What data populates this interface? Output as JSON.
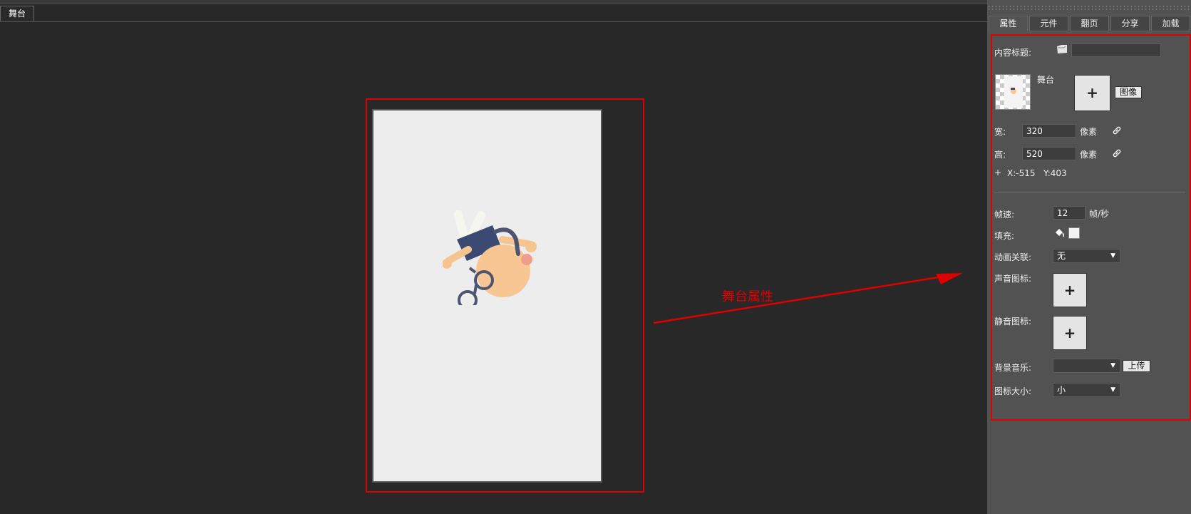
{
  "doc_tab": "舞台",
  "annotation": "舞台属性",
  "panel": {
    "tabs": [
      "属性",
      "元件",
      "翻页",
      "分享",
      "加载"
    ],
    "content_title_label": "内容标题:",
    "content_title_value": "",
    "stage_name": "舞台",
    "image_button": "图像",
    "width_label": "宽:",
    "width_value": "320",
    "height_label": "高:",
    "height_value": "520",
    "unit": "像素",
    "coord_x": "X:-515",
    "coord_y": "Y:403",
    "fps_label": "帧速:",
    "fps_value": "12",
    "fps_unit": "帧/秒",
    "fill_label": "填充:",
    "fill_color": "#f2f2f2",
    "anim_label": "动画关联:",
    "anim_value": "无",
    "sound_icon_label": "声音图标:",
    "mute_icon_label": "静音图标:",
    "bgm_label": "背景音乐:",
    "bgm_value": "",
    "upload_button": "上传",
    "icon_size_label": "图标大小:",
    "icon_size_value": "小"
  },
  "colors": {
    "highlight": "#e00000",
    "stage_bg": "#ededed",
    "panel_bg": "#525252",
    "canvas_bg": "#282828"
  }
}
